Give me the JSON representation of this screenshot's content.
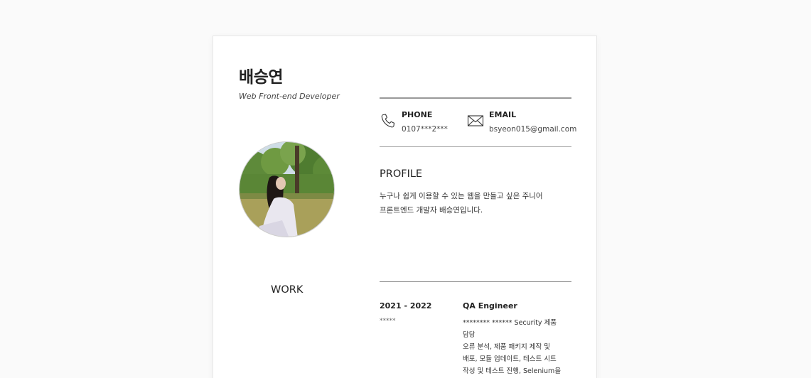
{
  "header": {
    "name": "배승연",
    "role": "Web Front-end Developer"
  },
  "contact": {
    "phone": {
      "label": "PHONE",
      "value": "0107***2***",
      "icon": "phone-icon"
    },
    "email": {
      "label": "EMAIL",
      "value": "bsyeon015@gmail.com",
      "icon": "envelope-icon"
    }
  },
  "profile": {
    "title": "PROFILE",
    "lines": [
      "누구나 쉽게 이용할 수 있는 웹을 만들고 싶은 주니어",
      "프론트엔드 개발자 배승연입니다."
    ]
  },
  "work": {
    "title": "WORK",
    "entries": [
      {
        "period": "2021 - 2022",
        "company": "*****",
        "position": "QA Engineer",
        "description": [
          "******** ****** Security 제품",
          "담당",
          "오류 분석, 제품 패키지 제작 및",
          "배포, 모듈 업데이트, 테스트 시트",
          "작성 및 테스트 진행, Selenium을"
        ]
      }
    ]
  },
  "colors": {
    "background": "#fafafa",
    "card": "#ffffff",
    "text": "#222222",
    "rule": "#8a8a8a"
  }
}
